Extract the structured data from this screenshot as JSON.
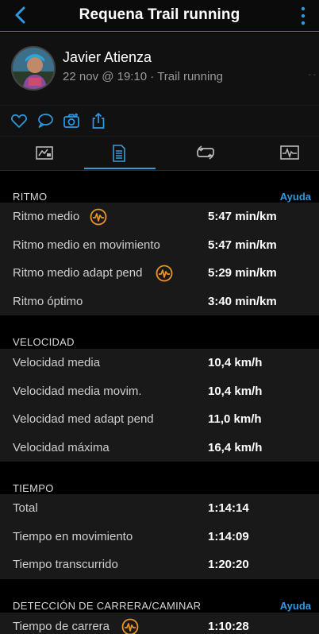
{
  "header": {
    "title": "Requena Trail running"
  },
  "profile": {
    "name": "Javier Atienza",
    "meta": "22 nov @ 19:10 · Trail running",
    "dash": "- -"
  },
  "sections": {
    "ritmo": {
      "title": "RITMO",
      "help": "Ayuda",
      "rows": [
        {
          "label": "Ritmo medio",
          "value": "5:47 min/km"
        },
        {
          "label": "Ritmo medio en movimiento",
          "value": "5:47 min/km"
        },
        {
          "label": "Ritmo medio adapt pend",
          "value": "5:29 min/km"
        },
        {
          "label": "Ritmo óptimo",
          "value": "3:40 min/km"
        }
      ]
    },
    "velocidad": {
      "title": "VELOCIDAD",
      "rows": [
        {
          "label": "Velocidad media",
          "value": "10,4 km/h"
        },
        {
          "label": "Velocidad media movim.",
          "value": "10,4 km/h"
        },
        {
          "label": "Velocidad med adapt pend",
          "value": "11,0 km/h"
        },
        {
          "label": "Velocidad máxima",
          "value": "16,4 km/h"
        }
      ]
    },
    "tiempo": {
      "title": "TIEMPO",
      "rows": [
        {
          "label": "Total",
          "value": "1:14:14"
        },
        {
          "label": "Tiempo en movimiento",
          "value": "1:14:09"
        },
        {
          "label": "Tiempo transcurrido",
          "value": "1:20:20"
        }
      ]
    },
    "deteccion": {
      "title": "DETECCIÓN DE CARRERA/CAMINAR",
      "help": "Ayuda",
      "rows": [
        {
          "label": "Tiempo de carrera",
          "value": "1:10:28"
        }
      ]
    }
  },
  "colors": {
    "accent": "#2e9ae0",
    "badge": "#e8962a",
    "topbar_line": "#2a7fb0"
  },
  "icons": {
    "back": "chevron-left-icon",
    "menu": "kebab-menu-icon",
    "badge": "performance-wave-icon",
    "actions": [
      "heart-icon",
      "comment-icon",
      "camera-icon",
      "share-icon"
    ],
    "tabs": [
      "overview-icon",
      "stats-icon",
      "laps-icon",
      "charts-icon"
    ]
  }
}
